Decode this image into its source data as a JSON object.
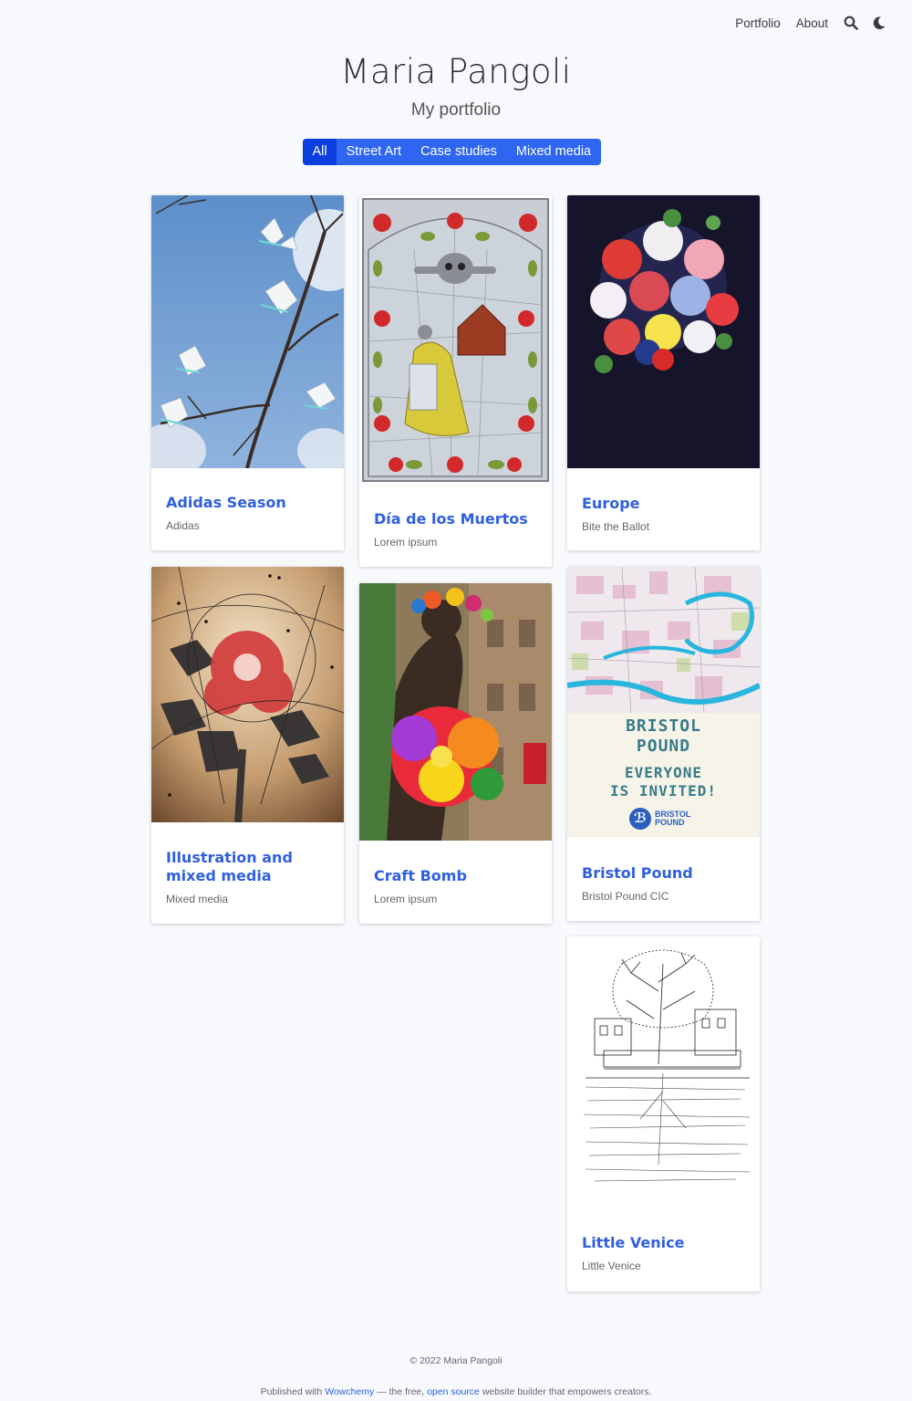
{
  "nav": {
    "items": [
      "Portfolio",
      "About"
    ],
    "icons": [
      "search-icon",
      "moon-icon"
    ]
  },
  "header": {
    "title": "Maria Pangoli",
    "subtitle": "My portfolio"
  },
  "filters": {
    "items": [
      "All",
      "Street Art",
      "Case studies",
      "Mixed media"
    ],
    "selected": "All",
    "accent": "#2e66f2",
    "active_color": "#0c3fe0"
  },
  "cards": [
    {
      "title": "Adidas Season",
      "subtitle": "Adidas"
    },
    {
      "title": "Día de los Muertos",
      "subtitle": "Lorem ipsum"
    },
    {
      "title": "Europe",
      "subtitle": "Bite the Ballot"
    },
    {
      "title": "Illustration and mixed media",
      "subtitle": "Mixed media"
    },
    {
      "title": "Craft Bomb",
      "subtitle": "Lorem ipsum"
    },
    {
      "title": "Bristol Pound",
      "subtitle": "Bristol Pound CIC"
    },
    {
      "title": "Little Venice",
      "subtitle": "Little Venice"
    }
  ],
  "images": {
    "bristol_pound_poster": {
      "line1": "BRISTOL",
      "line2": "POUND",
      "line3": "EVERYONE",
      "line4": "IS INVITED!",
      "logo_line1": "BRISTOL",
      "logo_line2": "POUND"
    }
  },
  "footer": {
    "copyright": "© 2022 Maria Pangoli",
    "published_prefix": "Published with",
    "wowchemy": "Wowchemy",
    "middle": "— the free,",
    "open_source": "open source",
    "suffix": "website builder that empowers creators."
  }
}
